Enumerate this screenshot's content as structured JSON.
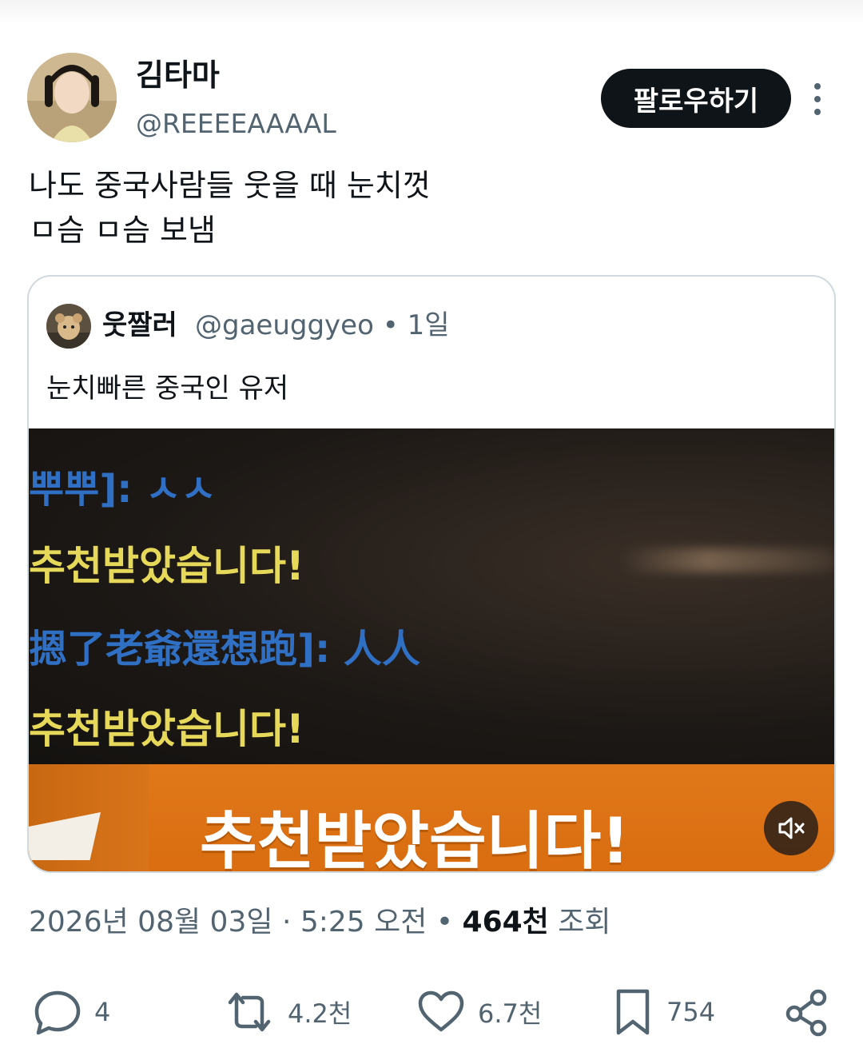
{
  "author": {
    "display_name": "김타마",
    "handle": "@REEEEAAAAL"
  },
  "follow_button_label": "팔로우하기",
  "tweet_text_lines": [
    "나도 중국사람들 웃을 때 눈치껏",
    "ㅁ슴 ㅁ슴 보냄"
  ],
  "quoted_tweet": {
    "display_name": "웃짤러",
    "handle": "@gaeuggyeo",
    "separator": "•",
    "time": "1일",
    "text": "눈치빠른 중국인 유저",
    "media": {
      "chat_lines": [
        "뿌뿌]: ㅅㅅ",
        "추천받았습니다!",
        "摁了老爺還想跑]: 人人",
        "추천받았습니다!"
      ],
      "banner_text": "추천받았습니다!",
      "mute_icon": "volume-mute-icon"
    }
  },
  "meta": {
    "date": "2026년 08월 03일",
    "dot1": "·",
    "time": "5:25 오전",
    "dot2": "•",
    "views_count": "464천",
    "views_label": "조회"
  },
  "actions": {
    "reply": {
      "icon": "reply-icon",
      "count": "4"
    },
    "retweet": {
      "icon": "retweet-icon",
      "count": "4.2천"
    },
    "like": {
      "icon": "heart-icon",
      "count": "6.7천"
    },
    "bookmark": {
      "icon": "bookmark-icon",
      "count": "754"
    },
    "share": {
      "icon": "share-icon"
    }
  },
  "colors": {
    "text_primary": "#0f1419",
    "text_secondary": "#536471",
    "border": "#cfd9de",
    "follow_bg": "#0f1419",
    "chat_blue": "#2f6fc4",
    "chat_yellow": "#e6d95a",
    "banner_orange": "#e0781a"
  }
}
